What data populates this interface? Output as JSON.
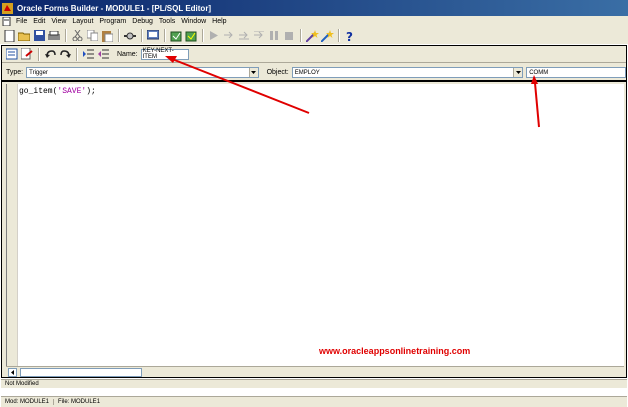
{
  "window": {
    "title": "Oracle Forms Builder - MODULE1 - [PL/SQL Editor]"
  },
  "menu": [
    "File",
    "Edit",
    "View",
    "Layout",
    "Program",
    "Debug",
    "Tools",
    "Window",
    "Help"
  ],
  "editor": {
    "name_label": "Name:",
    "name_value": "KEY-NEXT-ITEM",
    "type_label": "Type:",
    "type_value": "Trigger",
    "object_label": "Object:",
    "object_value": "EMPLOY",
    "item_value": "COMM",
    "code": {
      "prefix": "go_item(",
      "string": "'SAVE'",
      "suffix": ");"
    },
    "watermark": "www.oracleappsonlinetraining.com"
  },
  "status": {
    "line1": "Not Modified",
    "module": "Mod: MODULE1",
    "file": "File: MODULE1"
  },
  "colors": {
    "titlebar": "#0a246a",
    "annotation_arrow": "#e00000",
    "code_string": "#a000a0"
  }
}
